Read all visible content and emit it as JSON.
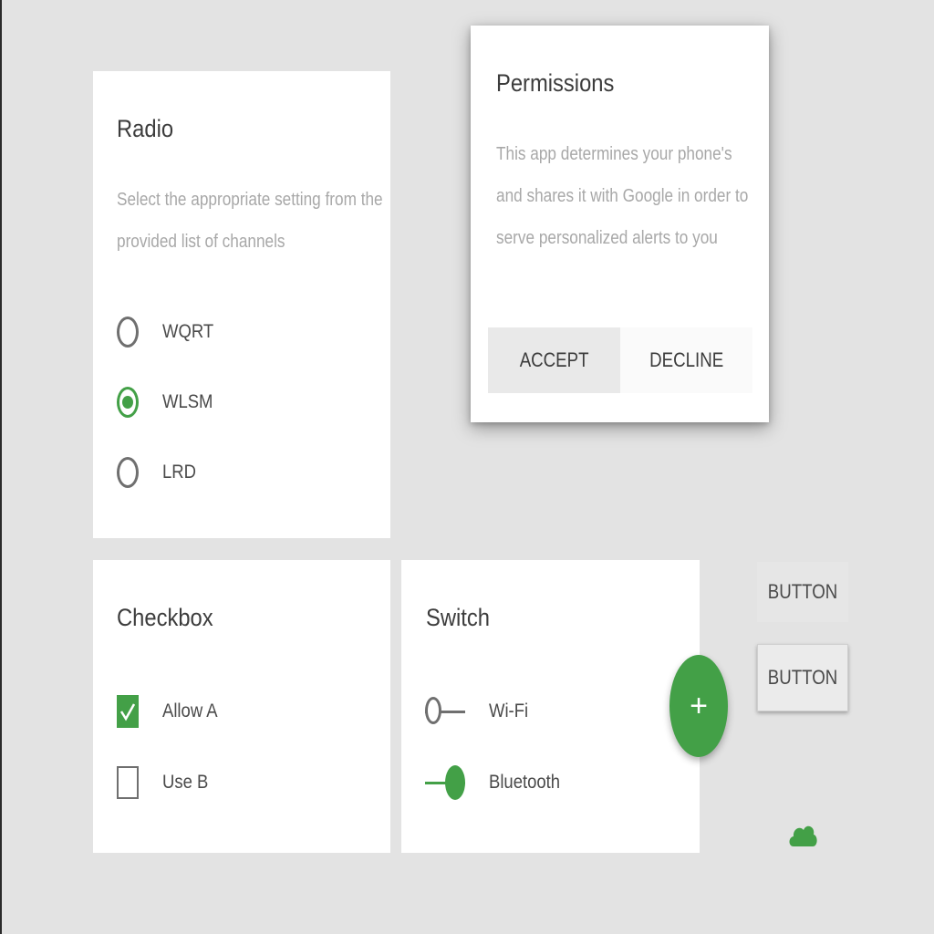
{
  "colors": {
    "accent": "#43a047",
    "background": "#e3e3e3",
    "card": "#ffffff",
    "muted_text": "#a8a8a8"
  },
  "radio_card": {
    "title": "Radio",
    "description": "Select the appropriate setting from the provided list of channels",
    "options": [
      {
        "label": "WQRT",
        "selected": false
      },
      {
        "label": "WLSM",
        "selected": true
      },
      {
        "label": "LRD",
        "selected": false
      }
    ]
  },
  "permissions_dialog": {
    "title": "Permissions",
    "body": "This app determines your phone's and shares it with Google in order to serve personalized alerts to you",
    "accept_label": "ACCEPT",
    "decline_label": "DECLINE"
  },
  "checkbox_card": {
    "title": "Checkbox",
    "items": [
      {
        "label": "Allow A",
        "checked": true
      },
      {
        "label": "Use B",
        "checked": false
      }
    ]
  },
  "switch_card": {
    "title": "Switch",
    "items": [
      {
        "label": "Wi-Fi",
        "on": false
      },
      {
        "label": "Bluetooth",
        "on": true
      }
    ]
  },
  "fab": {
    "icon": "plus-icon",
    "glyph": "+"
  },
  "buttons": {
    "flat_label": "BUTTON",
    "raised_label": "BUTTON"
  },
  "cloud": {
    "icon": "cloud-icon"
  }
}
